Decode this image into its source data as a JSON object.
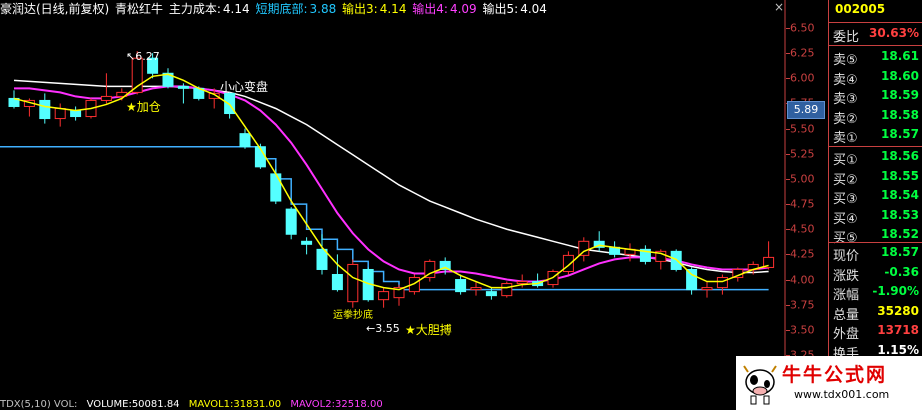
{
  "title": {
    "stock": "豪润达(日线,前复权)",
    "indicator": "青松红牛",
    "main_cost_label": "主力成本:",
    "main_cost_value": "4.14",
    "short_bottom_label": "短期底部:",
    "short_bottom_value": "3.88",
    "output3_label": "输出3:",
    "output3_value": "4.14",
    "output4_label": "输出4:",
    "output4_value": "4.09",
    "output5_label": "输出5:",
    "output5_value": "4.04",
    "close_glyph": "×"
  },
  "annotations": {
    "high_marker": "6.27",
    "add_position": "★加仓",
    "caution": "小心变盘",
    "low_marker": "3.55",
    "bold_buy": "★大胆搏",
    "bottom_tag": "运拳抄底"
  },
  "current_price_tag": "5.89",
  "price_scale": [
    "6.50",
    "6.25",
    "6.00",
    "5.75",
    "5.50",
    "5.25",
    "5.00",
    "4.75",
    "4.50",
    "4.25",
    "4.00",
    "3.75",
    "3.50",
    "3.25"
  ],
  "panel": {
    "code": "002005",
    "committee_ratio_label": "委比",
    "committee_ratio_value": "30.63%",
    "asks": [
      {
        "label": "卖⑤",
        "value": "18.61"
      },
      {
        "label": "卖④",
        "value": "18.60"
      },
      {
        "label": "卖③",
        "value": "18.59"
      },
      {
        "label": "卖②",
        "value": "18.58"
      },
      {
        "label": "卖①",
        "value": "18.57"
      }
    ],
    "bids": [
      {
        "label": "买①",
        "value": "18.56"
      },
      {
        "label": "买②",
        "value": "18.55"
      },
      {
        "label": "买③",
        "value": "18.54"
      },
      {
        "label": "买④",
        "value": "18.53"
      },
      {
        "label": "买⑤",
        "value": "18.52"
      }
    ],
    "stats": [
      {
        "label": "现价",
        "value": "18.57"
      },
      {
        "label": "涨跌",
        "value": "-0.36"
      },
      {
        "label": "涨幅",
        "value": "-1.90%"
      },
      {
        "label": "总量",
        "value": "35280"
      },
      {
        "label": "外盘",
        "value": "13718"
      },
      {
        "label": "换手",
        "value": "1.15%"
      }
    ]
  },
  "watermark": {
    "title": "牛牛公式网",
    "url": "www.tdx001.com"
  },
  "bottom_bar": {
    "item1": "TDX(5,10) VOL:",
    "item2": "VOLUME:50081.84",
    "item3": "MAVOL1:31831.00",
    "item4": "MAVOL2:32518.00"
  },
  "chart_data": {
    "type": "candlestick",
    "ylim": [
      3.25,
      6.5
    ],
    "candles": [
      {
        "o": 5.8,
        "h": 5.88,
        "l": 5.7,
        "c": 5.72
      },
      {
        "o": 5.72,
        "h": 5.8,
        "l": 5.62,
        "c": 5.78
      },
      {
        "o": 5.78,
        "h": 5.85,
        "l": 5.55,
        "c": 5.6
      },
      {
        "o": 5.6,
        "h": 5.75,
        "l": 5.52,
        "c": 5.7
      },
      {
        "o": 5.68,
        "h": 5.72,
        "l": 5.58,
        "c": 5.62
      },
      {
        "o": 5.62,
        "h": 5.8,
        "l": 5.6,
        "c": 5.78
      },
      {
        "o": 5.78,
        "h": 6.05,
        "l": 5.75,
        "c": 5.82
      },
      {
        "o": 5.82,
        "h": 5.9,
        "l": 5.78,
        "c": 5.86
      },
      {
        "o": 5.86,
        "h": 6.27,
        "l": 5.84,
        "c": 6.2
      },
      {
        "o": 6.2,
        "h": 6.25,
        "l": 6.0,
        "c": 6.05
      },
      {
        "o": 6.05,
        "h": 6.1,
        "l": 5.9,
        "c": 5.92
      },
      {
        "o": 5.92,
        "h": 5.95,
        "l": 5.75,
        "c": 5.9
      },
      {
        "o": 5.9,
        "h": 5.92,
        "l": 5.78,
        "c": 5.8
      },
      {
        "o": 5.8,
        "h": 5.9,
        "l": 5.7,
        "c": 5.85
      },
      {
        "o": 5.85,
        "h": 5.86,
        "l": 5.6,
        "c": 5.65
      },
      {
        "o": 5.45,
        "h": 5.5,
        "l": 5.3,
        "c": 5.32
      },
      {
        "o": 5.32,
        "h": 5.35,
        "l": 5.1,
        "c": 5.12
      },
      {
        "o": 5.05,
        "h": 5.1,
        "l": 4.75,
        "c": 4.78
      },
      {
        "o": 4.7,
        "h": 4.72,
        "l": 4.4,
        "c": 4.45
      },
      {
        "o": 4.38,
        "h": 4.42,
        "l": 4.25,
        "c": 4.35
      },
      {
        "o": 4.3,
        "h": 4.45,
        "l": 4.05,
        "c": 4.1
      },
      {
        "o": 4.05,
        "h": 4.25,
        "l": 3.88,
        "c": 3.9
      },
      {
        "o": 3.78,
        "h": 4.2,
        "l": 3.72,
        "c": 4.15
      },
      {
        "o": 4.1,
        "h": 4.12,
        "l": 3.78,
        "c": 3.8
      },
      {
        "o": 3.8,
        "h": 3.92,
        "l": 3.72,
        "c": 3.88
      },
      {
        "o": 3.82,
        "h": 3.95,
        "l": 3.74,
        "c": 3.92
      },
      {
        "o": 3.88,
        "h": 4.05,
        "l": 3.85,
        "c": 4.02
      },
      {
        "o": 4.02,
        "h": 4.2,
        "l": 3.98,
        "c": 4.18
      },
      {
        "o": 4.18,
        "h": 4.22,
        "l": 4.05,
        "c": 4.1
      },
      {
        "o": 4.0,
        "h": 4.05,
        "l": 3.85,
        "c": 3.88
      },
      {
        "o": 3.9,
        "h": 3.98,
        "l": 3.84,
        "c": 3.92
      },
      {
        "o": 3.88,
        "h": 3.92,
        "l": 3.8,
        "c": 3.84
      },
      {
        "o": 3.84,
        "h": 3.98,
        "l": 3.82,
        "c": 3.96
      },
      {
        "o": 3.96,
        "h": 4.05,
        "l": 3.92,
        "c": 3.98
      },
      {
        "o": 3.98,
        "h": 4.06,
        "l": 3.92,
        "c": 3.94
      },
      {
        "o": 3.95,
        "h": 4.1,
        "l": 3.92,
        "c": 4.08
      },
      {
        "o": 4.08,
        "h": 4.28,
        "l": 4.05,
        "c": 4.24
      },
      {
        "o": 4.24,
        "h": 4.42,
        "l": 4.18,
        "c": 4.38
      },
      {
        "o": 4.38,
        "h": 4.48,
        "l": 4.28,
        "c": 4.32
      },
      {
        "o": 4.32,
        "h": 4.38,
        "l": 4.22,
        "c": 4.25
      },
      {
        "o": 4.25,
        "h": 4.36,
        "l": 4.18,
        "c": 4.3
      },
      {
        "o": 4.3,
        "h": 4.34,
        "l": 4.15,
        "c": 4.18
      },
      {
        "o": 4.18,
        "h": 4.3,
        "l": 4.1,
        "c": 4.28
      },
      {
        "o": 4.28,
        "h": 4.3,
        "l": 4.08,
        "c": 4.1
      },
      {
        "o": 4.1,
        "h": 4.12,
        "l": 3.85,
        "c": 3.9
      },
      {
        "o": 3.9,
        "h": 3.98,
        "l": 3.82,
        "c": 3.92
      },
      {
        "o": 3.92,
        "h": 4.05,
        "l": 3.85,
        "c": 4.02
      },
      {
        "o": 4.02,
        "h": 4.12,
        "l": 3.98,
        "c": 4.1
      },
      {
        "o": 4.1,
        "h": 4.18,
        "l": 4.05,
        "c": 4.15
      },
      {
        "o": 4.12,
        "h": 4.38,
        "l": 4.1,
        "c": 4.22
      }
    ],
    "lines": {
      "yellow": [
        5.8,
        5.76,
        5.72,
        5.7,
        5.68,
        5.7,
        5.74,
        5.8,
        5.92,
        6.02,
        6.04,
        5.98,
        5.9,
        5.84,
        5.74,
        5.52,
        5.3,
        5.05,
        4.78,
        4.55,
        4.32,
        4.15,
        4.02,
        3.96,
        3.92,
        3.9,
        3.96,
        4.06,
        4.12,
        4.04,
        3.98,
        3.92,
        3.92,
        3.95,
        3.96,
        4.02,
        4.14,
        4.28,
        4.34,
        4.32,
        4.3,
        4.28,
        4.26,
        4.2,
        4.05,
        3.98,
        3.98,
        4.04,
        4.1,
        4.14
      ],
      "magenta": [
        5.9,
        5.9,
        5.88,
        5.86,
        5.82,
        5.8,
        5.8,
        5.82,
        5.86,
        5.9,
        5.92,
        5.92,
        5.9,
        5.88,
        5.84,
        5.78,
        5.68,
        5.54,
        5.36,
        5.14,
        4.9,
        4.66,
        4.46,
        4.3,
        4.18,
        4.1,
        4.06,
        4.06,
        4.08,
        4.08,
        4.06,
        4.03,
        4.0,
        3.98,
        3.98,
        4.0,
        4.04,
        4.1,
        4.16,
        4.2,
        4.22,
        4.22,
        4.21,
        4.19,
        4.15,
        4.12,
        4.1,
        4.1,
        4.1,
        4.12
      ],
      "white": [
        5.98,
        5.97,
        5.96,
        5.95,
        5.94,
        5.93,
        5.92,
        5.92,
        5.92,
        5.92,
        5.92,
        5.91,
        5.9,
        5.88,
        5.86,
        5.82,
        5.76,
        5.7,
        5.62,
        5.54,
        5.44,
        5.34,
        5.24,
        5.14,
        5.04,
        4.94,
        4.86,
        4.78,
        4.72,
        4.66,
        4.6,
        4.55,
        4.5,
        4.46,
        4.42,
        4.38,
        4.34,
        4.3,
        4.28,
        4.26,
        4.24,
        4.22,
        4.2,
        4.17,
        4.13,
        4.1,
        4.08,
        4.07,
        4.07,
        4.08
      ],
      "cyan_step": [
        5.32,
        5.32,
        5.32,
        5.32,
        5.32,
        5.32,
        5.32,
        5.32,
        5.32,
        5.32,
        5.32,
        5.32,
        5.32,
        5.32,
        5.32,
        5.32,
        5.2,
        5.0,
        4.75,
        4.5,
        4.4,
        4.3,
        4.18,
        4.08,
        3.98,
        3.9,
        3.9,
        3.9,
        3.9,
        3.9,
        3.9,
        3.9,
        3.9,
        3.9,
        3.9,
        3.9,
        3.9,
        3.9,
        3.9,
        3.9,
        3.9,
        3.9,
        3.9,
        3.9,
        3.9,
        3.9,
        3.9,
        3.9,
        3.9,
        3.9
      ]
    }
  }
}
